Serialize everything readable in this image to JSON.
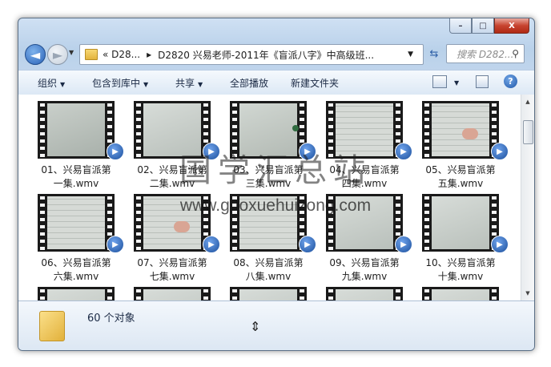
{
  "window": {
    "buttons": {
      "min": "–",
      "max": "□",
      "close": "X"
    }
  },
  "navbar": {
    "back_glyph": "◄",
    "forward_glyph": "►",
    "address": {
      "crumb1": "«  D28...",
      "sep": "▸",
      "crumb2": "D2820 兴易老师-2011年《盲派八字》中高级班..."
    },
    "search_placeholder": "搜索 D282..."
  },
  "toolbar": {
    "organize": "组织",
    "include_library": "包含到库中",
    "share": "共享",
    "play_all": "全部播放",
    "new_folder": "新建文件夹"
  },
  "files": [
    {
      "line1": "01、兴易盲派第",
      "line2": "一集.wmv",
      "scene": "dark"
    },
    {
      "line1": "02、兴易盲派第",
      "line2": "二集.wmv",
      "scene": "plain"
    },
    {
      "line1": "03、兴易盲派第",
      "line2": "三集.wmv",
      "scene": "dot"
    },
    {
      "line1": "04、兴易盲派第",
      "line2": "四集.wmv",
      "scene": "text"
    },
    {
      "line1": "05、兴易盲派第",
      "line2": "五集.wmv",
      "scene": "texthand"
    },
    {
      "line1": "06、兴易盲派第",
      "line2": "六集.wmv",
      "scene": "text"
    },
    {
      "line1": "07、兴易盲派第",
      "line2": "七集.wmv",
      "scene": "texthand"
    },
    {
      "line1": "08、兴易盲派第",
      "line2": "八集.wmv",
      "scene": "text"
    },
    {
      "line1": "09、兴易盲派第",
      "line2": "九集.wmv",
      "scene": "plain"
    },
    {
      "line1": "10、兴易盲派第",
      "line2": "十集.wmv",
      "scene": "plain"
    }
  ],
  "details": {
    "count": "60 个对象"
  },
  "watermark": {
    "cn": "国学汇总站",
    "url": "www.guoxuehuizong.com"
  },
  "colors": {
    "accent": "#2a62b8",
    "close": "#c7432f"
  }
}
